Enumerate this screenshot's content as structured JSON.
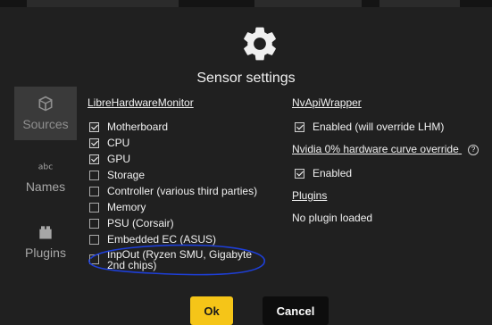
{
  "dialog": {
    "title": "Sensor settings",
    "header_icon": "gear-icon"
  },
  "nav": {
    "items": [
      {
        "label": "Sources",
        "icon": "cube-icon",
        "active": true
      },
      {
        "label": "Names",
        "icon": "abc-icon",
        "active": false
      },
      {
        "label": "Plugins",
        "icon": "plugin-icon",
        "active": false
      }
    ]
  },
  "lhm": {
    "heading": "LibreHardwareMonitor",
    "items": [
      {
        "label": "Motherboard",
        "checked": true
      },
      {
        "label": "CPU",
        "checked": true
      },
      {
        "label": "GPU",
        "checked": true
      },
      {
        "label": "Storage",
        "checked": false
      },
      {
        "label": "Controller (various third parties)",
        "checked": false
      },
      {
        "label": "Memory",
        "checked": false
      },
      {
        "label": "PSU (Corsair)",
        "checked": false
      },
      {
        "label": "Embedded EC (ASUS)",
        "checked": false
      },
      {
        "label": "InpOut (Ryzen SMU, Gigabyte 2nd chips)",
        "checked": false
      }
    ]
  },
  "nvapi": {
    "heading": "NvApiWrapper",
    "enabled_label": "Enabled (will override LHM)",
    "enabled_checked": true
  },
  "nvidia_curve": {
    "heading": "Nvidia 0% hardware curve override",
    "help_icon": "?",
    "enabled_label": "Enabled",
    "enabled_checked": true
  },
  "plugins": {
    "heading": "Plugins",
    "status": "No plugin loaded"
  },
  "buttons": {
    "ok_label": "Ok",
    "cancel_label": "Cancel"
  },
  "colors": {
    "accent": "#f5c518",
    "annotation": "#1e3fd8",
    "background": "#202020"
  }
}
